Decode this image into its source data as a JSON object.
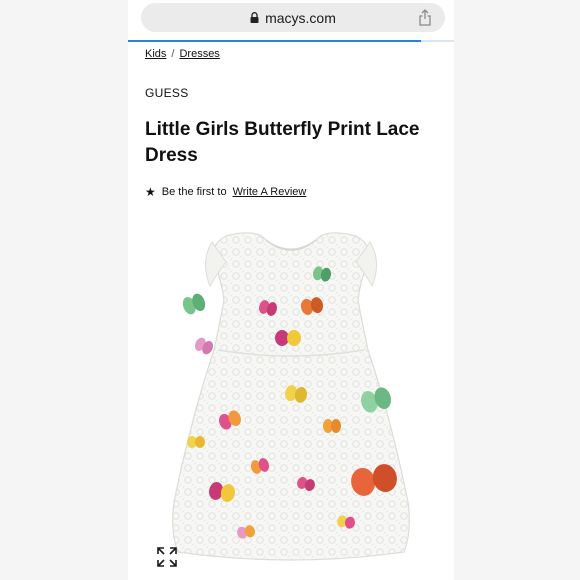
{
  "browser": {
    "url": "macys.com",
    "progress": 0.9,
    "progress_color": "#2c7fd6"
  },
  "breadcrumb": {
    "items": [
      "Kids",
      "Dresses"
    ],
    "separator": "/"
  },
  "product": {
    "brand": "GUESS",
    "title": "Little Girls Butterfly Print Lace Dress",
    "review_prefix": "Be the first to",
    "review_link": "Write A Review",
    "image_icon": "expand-icon"
  },
  "icons": {
    "lock": "lock-icon",
    "share": "share-icon",
    "star": "star-icon"
  }
}
